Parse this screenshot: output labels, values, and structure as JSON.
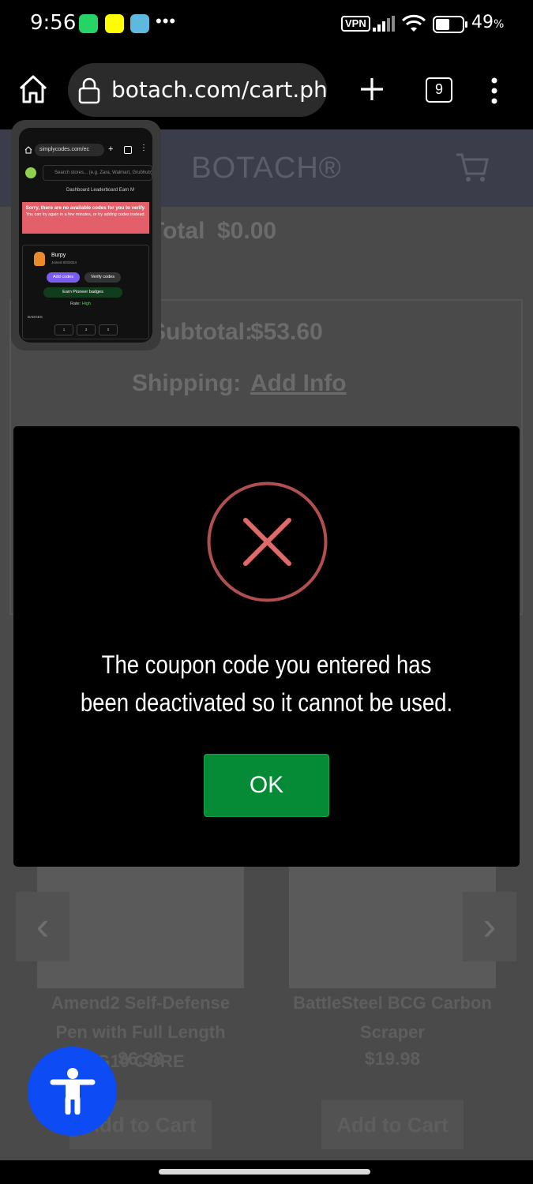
{
  "status_bar": {
    "time": "9:56",
    "vpn": "VPN",
    "battery_percent": "49",
    "battery_unit": "%",
    "app_icons": [
      "whatsapp-icon",
      "snapchat-icon",
      "app-icon"
    ]
  },
  "browser": {
    "url": "botach.com/cart.php",
    "tab_count": "9"
  },
  "page": {
    "logo": "BOTACH®",
    "total_label": "Total",
    "total_value": "$0.00",
    "subtotal_label": "Subtotal:",
    "subtotal_value": "$53.60",
    "shipping_label": "Shipping:",
    "shipping_value": "Add Info",
    "products": [
      {
        "name": "Amend2 Self-Defense Pen with Full Length G10 CORE",
        "price": "$6.98",
        "button": "Add to Cart"
      },
      {
        "name": "BattleSteel BCG Carbon Scraper",
        "price": "$19.98",
        "button": "Add to Cart"
      }
    ]
  },
  "pip": {
    "url": "simplycodes.com/ec",
    "search_placeholder": "Search stores... (e.g. Zara, Walmart, Grubhub)",
    "nav": "Dashboard   Leaderboard   Earn M",
    "alert_title": "Sorry, there are no available codes for you to verify.",
    "alert_sub": "You can try again in a few minutes, or try adding codes instead.",
    "user_name": "Burpy",
    "joined": "Joined 8/3/2024",
    "btn_add": "Add codes",
    "btn_verify": "Verify codes",
    "btn_earn": "Earn Pioneer badges",
    "rate_label": "Rate:",
    "rate_value": "High",
    "badges_label": "BADGES",
    "badges": [
      "1",
      "3",
      "0"
    ]
  },
  "modal": {
    "message": "The coupon code you entered has been deactivated so it cannot be used.",
    "ok_label": "OK",
    "accent_color": "#e06a6a",
    "button_color": "#058a35"
  }
}
